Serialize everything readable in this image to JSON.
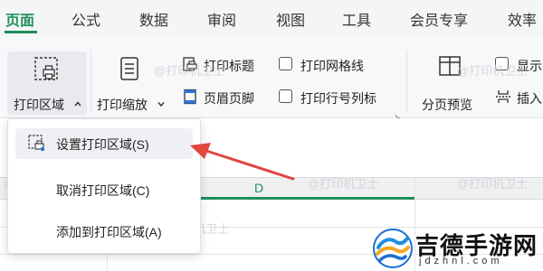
{
  "tabs": [
    {
      "label": "页面",
      "active": true
    },
    {
      "label": "公式"
    },
    {
      "label": "数据"
    },
    {
      "label": "审阅"
    },
    {
      "label": "视图"
    },
    {
      "label": "工具"
    },
    {
      "label": "会员专享"
    },
    {
      "label": "效率"
    }
  ],
  "ribbon": {
    "print_area_label": "打印区域",
    "print_scale_label": "打印缩放",
    "print_titles_label": "打印标题",
    "header_footer_label": "页眉页脚",
    "print_gridlines_label": "打印网格线",
    "print_row_col_label": "打印行号列标",
    "page_break_preview_label": "分页预览",
    "show_label": "显示",
    "insert_label": "插入",
    "launcher_icon": "dialog-launcher-icon"
  },
  "dropdown": {
    "items": [
      {
        "label": "设置打印区域(S)",
        "highlighted": true,
        "icon": "set-print-area-icon"
      },
      {
        "label": "取消打印区域(C)"
      },
      {
        "label": "添加到打印区域(A)"
      }
    ]
  },
  "sheet": {
    "column_header": "D"
  },
  "watermark": "@打印机卫士",
  "logo": {
    "text": "吉德手游网",
    "subtext": "jdzhnl.com"
  },
  "colors": {
    "accent": "#1f8f5a",
    "arrow": "#e0463f"
  }
}
